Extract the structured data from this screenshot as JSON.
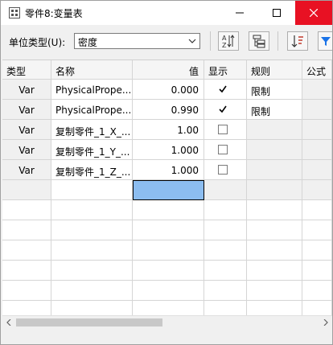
{
  "window": {
    "title": "零件8:变量表",
    "colors": {
      "close_hover": "#e81123",
      "selection": "#8cbdf0",
      "filter_icon": "#1a73e8"
    }
  },
  "toolbar": {
    "unit_type_label": "单位类型(U):",
    "unit_type_value": "密度",
    "buttons": [
      "sort-az-icon",
      "hierarchy-icon",
      "sort-order-icon",
      "filter-icon"
    ]
  },
  "table": {
    "columns": [
      "类型",
      "名称",
      "值",
      "显示",
      "规则",
      "公式"
    ],
    "rows": [
      {
        "type": "Var",
        "name": "PhysicalPrope...",
        "value": "0.000",
        "show": true,
        "rule": "限制"
      },
      {
        "type": "Var",
        "name": "PhysicalPrope...",
        "value": "0.990",
        "show": true,
        "rule": "限制"
      },
      {
        "type": "Var",
        "name": "复制零件_1_X_...",
        "value": "1.00",
        "show": false,
        "rule": ""
      },
      {
        "type": "Var",
        "name": "复制零件_1_Y_...",
        "value": "1.000",
        "show": false,
        "rule": ""
      },
      {
        "type": "Var",
        "name": "复制零件_1_Z_...",
        "value": "1.000",
        "show": false,
        "rule": ""
      }
    ]
  }
}
